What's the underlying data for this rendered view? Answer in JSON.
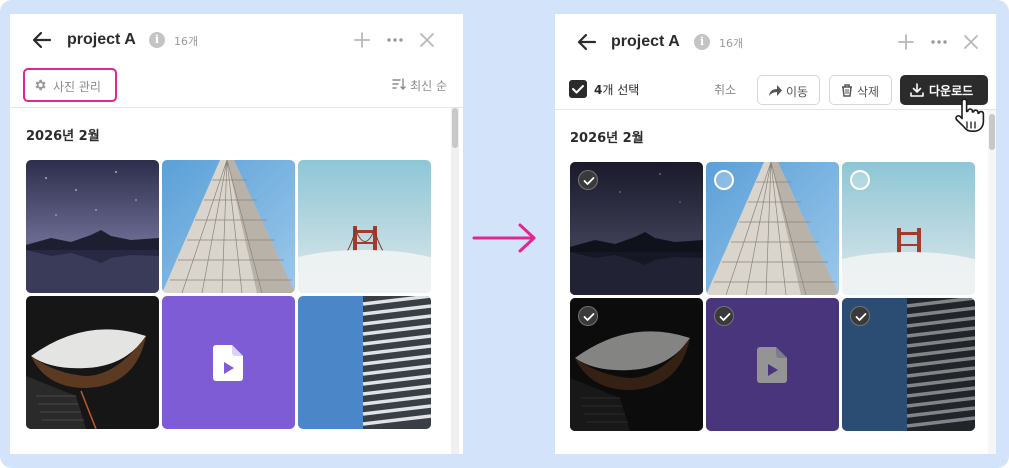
{
  "left": {
    "back_icon": "arrow-left-icon",
    "title": "project A",
    "info_icon": "info-icon",
    "count": "16개",
    "add_icon": "plus-icon",
    "more_icon": "more-horizontal-icon",
    "close_icon": "close-icon",
    "manage": {
      "icon": "gear-icon",
      "label": "사진 관리"
    },
    "sort": {
      "icon": "sort-icon",
      "label": "최신 순"
    },
    "section": "2026년 2월",
    "highlight_color": "#e4258f"
  },
  "transition_arrow": {
    "icon": "arrow-right-icon",
    "color": "#e4258f"
  },
  "right": {
    "back_icon": "arrow-left-icon",
    "title": "project A",
    "info_icon": "info-icon",
    "count": "16개",
    "add_icon": "plus-icon",
    "more_icon": "more-horizontal-icon",
    "close_icon": "close-icon",
    "selection": {
      "count": "4",
      "suffix": "개 선택",
      "checked": true
    },
    "cancel_label": "취소",
    "move": {
      "icon": "share-arrow-icon",
      "label": "이동"
    },
    "delete": {
      "icon": "trash-icon",
      "label": "삭제"
    },
    "download": {
      "icon": "download-icon",
      "label": "다운로드"
    },
    "cursor_icon": "hand-pointer-icon",
    "section": "2026년 2월",
    "photos_selected": [
      true,
      false,
      false,
      true,
      true,
      true
    ]
  },
  "photos": [
    {
      "name": "mountain-night",
      "kind": "image"
    },
    {
      "name": "skyscraper-facade",
      "kind": "image"
    },
    {
      "name": "bridge-fog",
      "kind": "image"
    },
    {
      "name": "tunnel-stairs",
      "kind": "image"
    },
    {
      "name": "video-file",
      "kind": "video",
      "icon": "video-file-icon",
      "color": "#7d5cd6"
    },
    {
      "name": "building-stripes",
      "kind": "image"
    }
  ]
}
